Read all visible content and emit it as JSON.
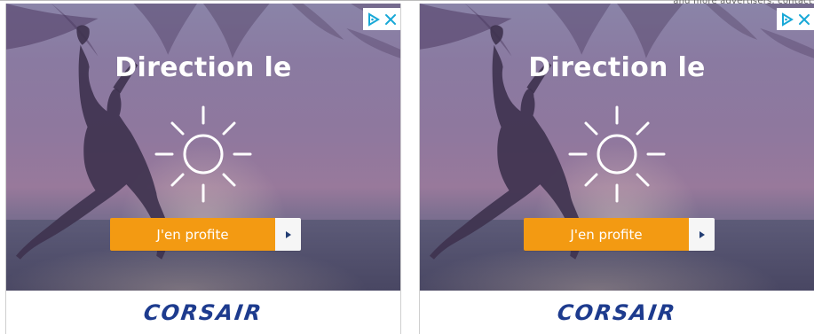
{
  "ads": [
    {
      "headline": "Direction le",
      "cta_label": "J'en profite",
      "brand": "CORSAIR"
    },
    {
      "headline": "Direction le",
      "cta_label": "J'en profite",
      "brand": "CORSAIR"
    }
  ],
  "icons": {
    "adchoices": "adchoices-icon",
    "close": "close-icon",
    "sun": "sun-icon",
    "play": "play-arrow-icon"
  },
  "colors": {
    "cta_orange": "#f39a12",
    "brand_blue": "#1d3b8e",
    "adchoices_cyan": "#18a8d7"
  }
}
